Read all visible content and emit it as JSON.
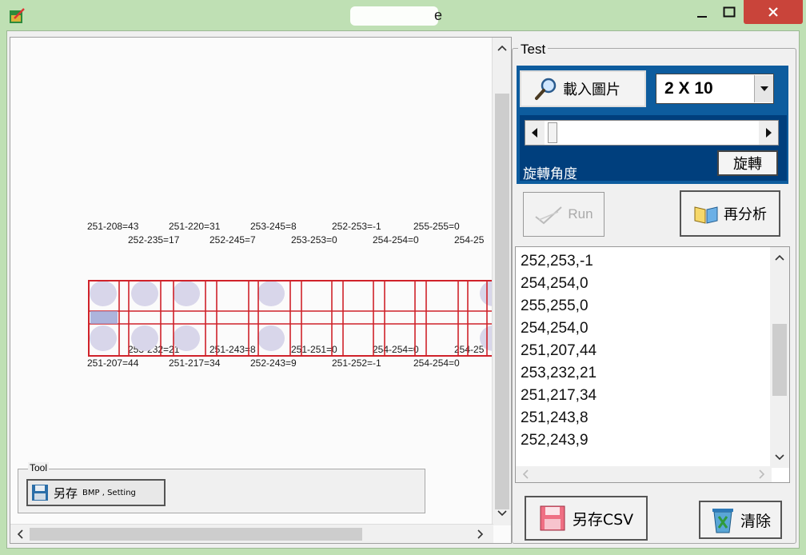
{
  "window": {
    "title": "e",
    "minimize": "—",
    "maximize": "☐",
    "close": "✕"
  },
  "image_panel": {
    "top_labels_row1": [
      "251-208=43",
      "251-220=31",
      "253-245=8",
      "252-253=-1",
      "255-255=0"
    ],
    "top_labels_row2": [
      "252-235=17",
      "252-245=7",
      "253-253=0",
      "254-254=0",
      "254-25"
    ],
    "bottom_labels_row1": [
      "253-232=21",
      "251-243=8",
      "251-251=0",
      "254-254=0",
      "254-25"
    ],
    "bottom_labels_row2": [
      "251-207=44",
      "251-217=34",
      "252-243=9",
      "251-252=-1",
      "254-254=0"
    ],
    "grid_color": "#d0222a"
  },
  "tool": {
    "legend": "Tool",
    "save_bmp_main": "另存",
    "save_bmp_sub": "BMP , Setting"
  },
  "test": {
    "legend": "Test",
    "load_image": "載入圖片",
    "grid_size": "2 X 10",
    "rotation_label": "旋轉角度",
    "rotate_button": "旋轉",
    "run_button": "Run",
    "reanalyze_button": "再分析",
    "results": [
      "252,253,-1",
      "254,254,0",
      "255,255,0",
      "254,254,0",
      "251,207,44",
      "253,232,21",
      "251,217,34",
      "251,243,8",
      "252,243,9"
    ],
    "save_csv": "另存CSV",
    "clear": "清除"
  },
  "colors": {
    "window_frame": "#bfe0b4",
    "blue_panel": "#0d5c9e",
    "close_button": "#c9443a"
  }
}
